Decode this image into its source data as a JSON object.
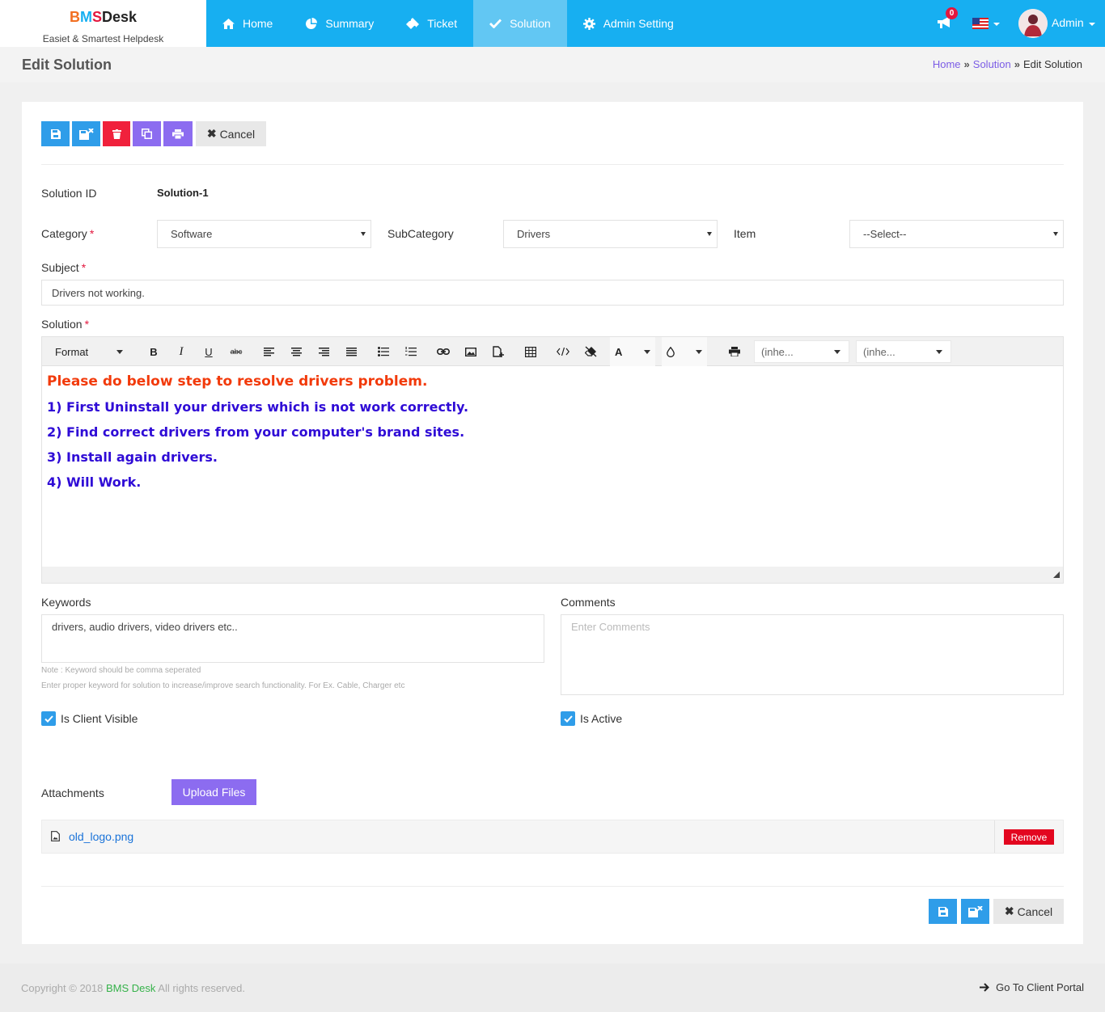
{
  "brand": {
    "logo_b": "B",
    "logo_m": "M",
    "logo_s": "S",
    "logo_desk": "Desk",
    "tagline": "Easiet & Smartest Helpdesk"
  },
  "nav": {
    "items": [
      {
        "label": "Home",
        "icon": "home-icon"
      },
      {
        "label": "Summary",
        "icon": "pie-chart-icon"
      },
      {
        "label": "Ticket",
        "icon": "ticket-icon"
      },
      {
        "label": "Solution",
        "icon": "check-icon",
        "active": true
      },
      {
        "label": "Admin Setting",
        "icon": "gear-icon"
      }
    ],
    "notification_count": "0",
    "user": "Admin"
  },
  "page": {
    "title": "Edit Solution",
    "breadcrumb": [
      "Home",
      "Solution",
      "Edit Solution"
    ]
  },
  "actions": {
    "cancel": "Cancel"
  },
  "form": {
    "solution_id_label": "Solution ID",
    "solution_id": "Solution-1",
    "category_label": "Category",
    "category": "Software",
    "subcategory_label": "SubCategory",
    "subcategory": "Drivers",
    "item_label": "Item",
    "item": "--Select--",
    "subject_label": "Subject",
    "subject": "Drivers not working.",
    "solution_label": "Solution",
    "keywords_label": "Keywords",
    "keywords": "drivers, audio drivers, video drivers etc..",
    "keywords_note1": "Note : Keyword should be comma seperated",
    "keywords_note2": "Enter proper keyword for solution to increase/improve search functionality. For Ex. Cable, Charger etc",
    "comments_label": "Comments",
    "comments_placeholder": "Enter Comments",
    "client_visible_label": "Is Client Visible",
    "is_active_label": "Is Active",
    "attachments_label": "Attachments",
    "upload_label": "Upload Files",
    "attachment_file": "old_logo.png",
    "remove_label": "Remove"
  },
  "editor": {
    "format_label": "Format",
    "font_label": "(inhe...",
    "size_label": "(inhe...",
    "lines": [
      "Please do below step to resolve drivers problem.",
      "1) First Uninstall your drivers which is not work correctly.",
      "2) Find correct drivers from your computer's brand sites.",
      "3) Install again drivers.",
      "4) Will Work."
    ],
    "colors": {
      "lead": "#f23a0b",
      "body": "#2f0bd6"
    }
  },
  "footer": {
    "copyright_prefix": "Copyright © 2018",
    "brand": "BMS Desk",
    "copyright_suffix": "All rights reserved.",
    "portal_link": "Go To Client Portal"
  },
  "colors": {
    "primary": "#17aff1",
    "accent": "#8c6cf0",
    "danger": "#e3061f"
  }
}
